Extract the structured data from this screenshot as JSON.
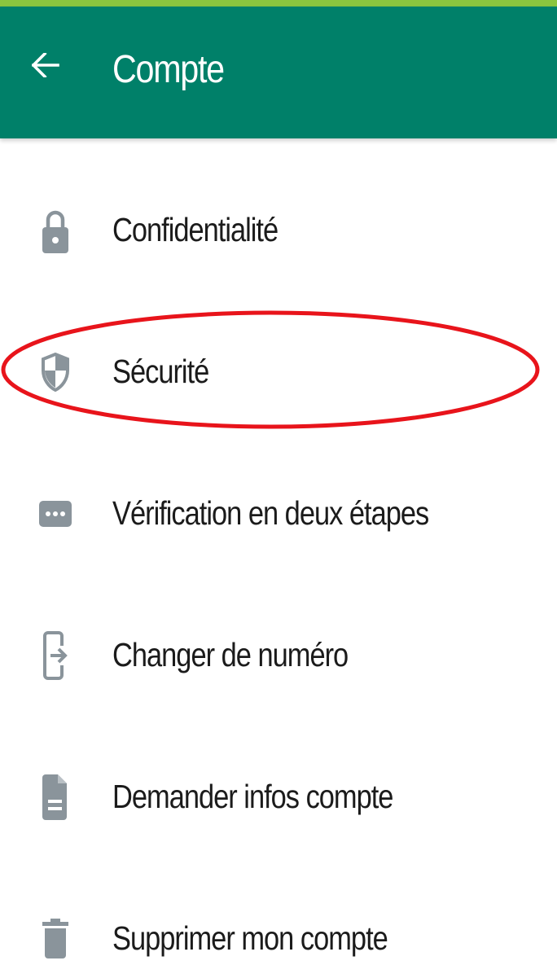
{
  "colors": {
    "status_strip": "#8bc53f",
    "app_bar": "#008069",
    "icon": "#8a949b",
    "highlight": "#e8141b"
  },
  "app_bar": {
    "back_icon": "arrow-left-icon",
    "title": "Compte"
  },
  "menu": {
    "items": [
      {
        "label": "Confidentialité",
        "icon": "lock-icon"
      },
      {
        "label": "Sécurité",
        "icon": "shield-icon",
        "highlighted": true
      },
      {
        "label": "Vérification en deux étapes",
        "icon": "dots-pin-icon"
      },
      {
        "label": "Changer de numéro",
        "icon": "phone-transfer-icon"
      },
      {
        "label": "Demander infos compte",
        "icon": "document-icon"
      },
      {
        "label": "Supprimer mon compte",
        "icon": "trash-icon"
      }
    ]
  }
}
